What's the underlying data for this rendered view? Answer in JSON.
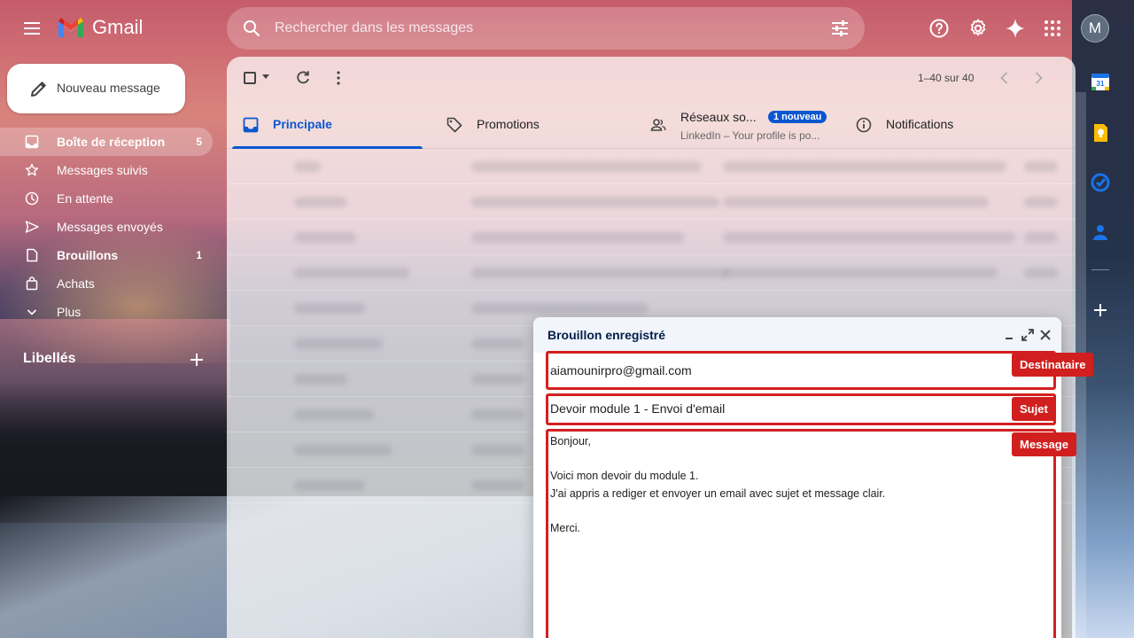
{
  "app": {
    "name": "Gmail"
  },
  "search": {
    "placeholder": "Rechercher dans les messages"
  },
  "user": {
    "avatar_letter": "M"
  },
  "compose_button": {
    "label": "Nouveau message"
  },
  "sidebar": {
    "items": [
      {
        "label": "Boîte de réception",
        "count": "5",
        "icon": "inbox-icon",
        "active": true
      },
      {
        "label": "Messages suivis",
        "count": "",
        "icon": "star-icon"
      },
      {
        "label": "En attente",
        "count": "",
        "icon": "clock-icon"
      },
      {
        "label": "Messages envoyés",
        "count": "",
        "icon": "send-icon"
      },
      {
        "label": "Brouillons",
        "count": "1",
        "icon": "draft-icon",
        "bold": true
      },
      {
        "label": "Achats",
        "count": "",
        "icon": "shopping-bag-icon"
      },
      {
        "label": "Plus",
        "count": "",
        "icon": "chevron-down-icon"
      }
    ],
    "labels_heading": "Libellés"
  },
  "toolbar": {
    "range": "1–40 sur 40"
  },
  "tabs": [
    {
      "label": "Principale",
      "icon": "inbox-icon",
      "active": true
    },
    {
      "label": "Promotions",
      "icon": "tag-icon"
    },
    {
      "label": "Réseaux so...",
      "icon": "people-icon",
      "badge": "1 nouveau",
      "subtitle": "LinkedIn – Your profile is po..."
    },
    {
      "label": "Notifications",
      "icon": "info-icon"
    }
  ],
  "draft": {
    "title": "Brouillon enregistré",
    "to": "aiamounirpro@gmail.com",
    "subject": "Devoir module 1 - Envoi d'email",
    "body": [
      "Bonjour,",
      "",
      "Voici mon devoir du module 1.",
      "J'ai appris a rediger et envoyer un email avec sujet et message clair.",
      "",
      "Merci."
    ]
  },
  "annotations": {
    "to_tag": "Destinataire",
    "subject_tag": "Sujet",
    "message_tag": "Message"
  },
  "colors": {
    "accent": "#0b57d0",
    "annotation": "#d11f1f"
  }
}
